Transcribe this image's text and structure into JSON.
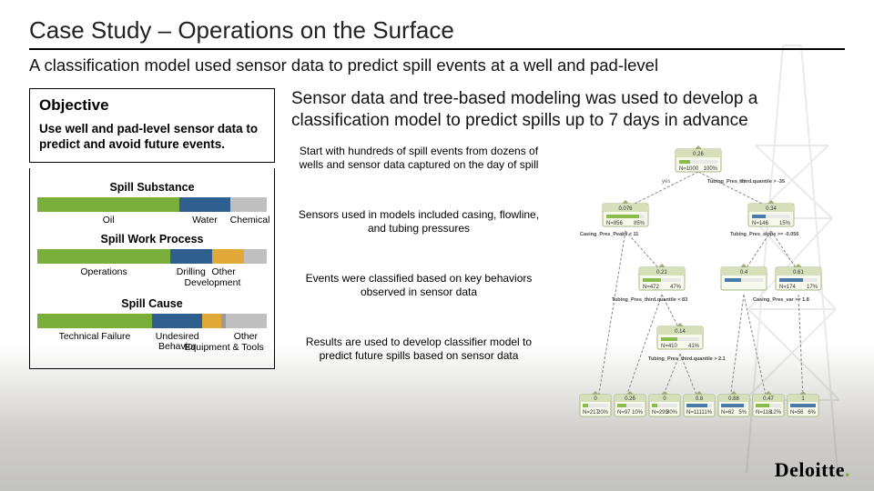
{
  "title": "Case Study – Operations on the Surface",
  "subtitle": "A classification model used sensor data to predict spill events at a well and pad-level",
  "objective": {
    "heading": "Objective",
    "body": "Use well and pad-level sensor data to predict and avoid future events."
  },
  "chart_data": [
    {
      "type": "bar",
      "title": "Spill Substance",
      "categories": [
        "Oil",
        "Water",
        "Chemical"
      ],
      "values": [
        62,
        22,
        16
      ],
      "colors": [
        "#7aae3a",
        "#2f5f8f",
        "#bfbfbf"
      ]
    },
    {
      "type": "bar",
      "title": "Spill Work Process",
      "categories": [
        "Operations",
        "Drilling",
        "Development",
        "Other"
      ],
      "values": [
        58,
        18,
        14,
        10
      ],
      "colors": [
        "#7aae3a",
        "#2f5f8f",
        "#e0a838",
        "#bfbfbf"
      ]
    },
    {
      "type": "bar",
      "title": "Spill Cause",
      "categories": [
        "Technical Failure",
        "Undesired Behavior",
        "Equipment & Tools",
        "Other"
      ],
      "values": [
        50,
        22,
        8,
        20
      ],
      "colors": [
        "#7aae3a",
        "#2f5f8f",
        "#e0a838",
        "#bfbfbf"
      ]
    }
  ],
  "charts": {
    "substance": {
      "title": "Spill Substance",
      "labels": [
        "Oil",
        "Water",
        "Chemical"
      ]
    },
    "process": {
      "title": "Spill Work Process",
      "labels": [
        "Operations",
        "Drilling",
        "Development",
        "Other"
      ]
    },
    "cause": {
      "title": "Spill Cause",
      "labels": [
        "Technical Failure",
        "Undesired Behavior",
        "Equipment & Tools",
        "Other"
      ]
    }
  },
  "headline": "Sensor data and tree-based modeling was used to develop a classification model to predict spills up to 7 days in advance",
  "steps": [
    "Start with hundreds of spill events from dozens of wells and sensor data captured on the day of spill",
    "Sensors used in models included casing, flowline, and tubing pressures",
    "Events were classified based on key behaviors observed in sensor data",
    "Results are used to develop classifier model to predict future spills based on sensor data"
  ],
  "tree": {
    "root": {
      "val": "0.26",
      "n": "N=1000",
      "pct": "100%",
      "split": "Tubing_Pres_third.quantile > -35"
    },
    "l1a": {
      "val": "0.076",
      "n": "N=856",
      "pct": "85%",
      "split": "Casing_Pres_Peaks < 11"
    },
    "l1b": {
      "val": "0.34",
      "n": "N=146",
      "pct": "15%",
      "split": "Tubing_Pres_slope >= -0.056"
    },
    "l2a": {
      "val": "0.21",
      "n": "N=472",
      "pct": "47%",
      "split": "Tubing_Pres_third.quantile < 83"
    },
    "l2b": {
      "val": "0.61",
      "n": "N=174",
      "pct": "17%",
      "split": "Casing_Pres_var >= 1.8"
    },
    "l3a": {
      "val": "0.14",
      "n": "N=410",
      "pct": "41%",
      "split": "Tubing_Pres_third.quantile > 2.1"
    },
    "leaves": [
      {
        "val": "0",
        "n": "N=217",
        "pct": "20%"
      },
      {
        "val": "0.26",
        "n": "N=97",
        "pct": "10%"
      },
      {
        "val": "0",
        "n": "N=299",
        "pct": "30%"
      },
      {
        "val": "0.8",
        "n": "N=111",
        "pct": "11%"
      },
      {
        "val": "0.88",
        "n": "N=62",
        "pct": "5%"
      },
      {
        "val": "0.47",
        "n": "N=118",
        "pct": "12%"
      },
      {
        "val": "1",
        "n": "N=56",
        "pct": "6%"
      }
    ]
  },
  "logo": "Deloitte"
}
